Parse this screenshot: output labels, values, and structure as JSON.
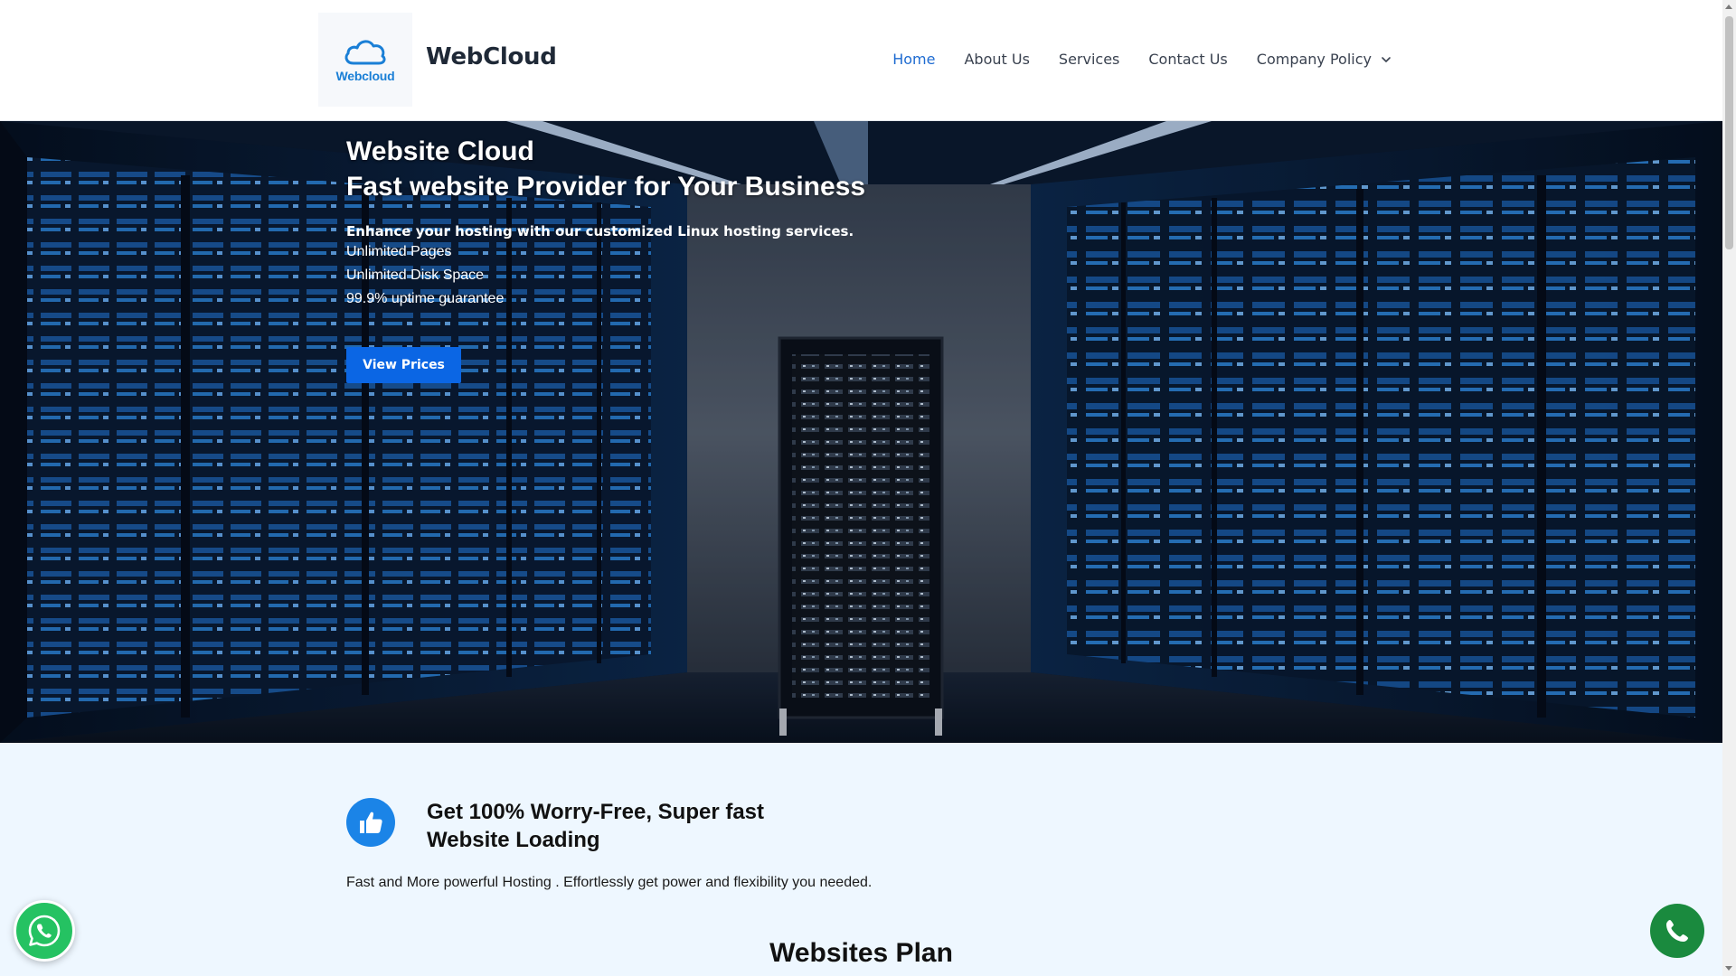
{
  "brand": {
    "logo_word": "Webcloud",
    "site_title": "WebCloud",
    "accent_color": "#1e6bd1",
    "button_color": "#0b66e4"
  },
  "nav": {
    "items": [
      {
        "label": "Home",
        "active": true
      },
      {
        "label": "About Us",
        "active": false
      },
      {
        "label": "Services",
        "active": false
      },
      {
        "label": "Contact Us",
        "active": false
      },
      {
        "label": "Company Policy",
        "active": false,
        "dropdown": true
      }
    ]
  },
  "hero": {
    "title_line1": "Website Cloud",
    "title_line2": "Fast website Provider for Your Business",
    "subtitle": "Enhance your hosting with our customized Linux hosting services.",
    "features": [
      "Unlimited Pages",
      "Unlimited Disk Space",
      "99.9% uptime guarantee"
    ],
    "cta_label": "View Prices",
    "background_icon": "server-room-image"
  },
  "feature": {
    "icon": "thumbs-up-icon",
    "title_line1": "Get 100% Worry-Free, Super fast",
    "title_line2": "Website Loading",
    "description": "Fast and More powerful Hosting . Effortlessly get power and flexibility you needed."
  },
  "plans": {
    "title": "Websites Plan"
  },
  "floating": {
    "whatsapp_icon": "whatsapp-icon",
    "phone_icon": "phone-icon"
  }
}
